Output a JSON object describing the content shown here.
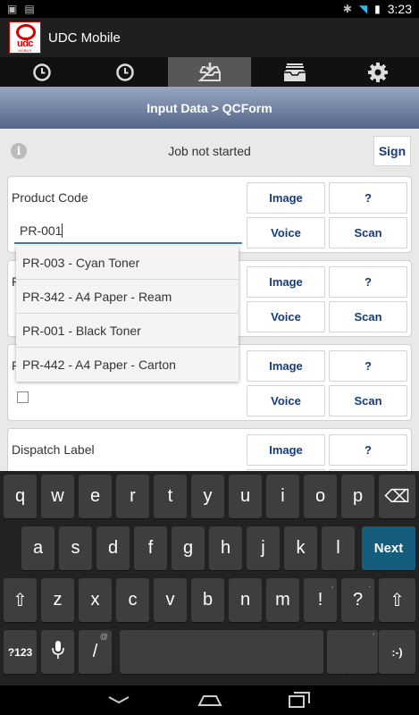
{
  "status_bar": {
    "time": "3:23"
  },
  "app": {
    "title": "UDC Mobile",
    "logo_text": "udc",
    "logo_subtext": "MOBILE"
  },
  "tabs": [
    {
      "icon": "clock-icon"
    },
    {
      "icon": "clock-icon"
    },
    {
      "icon": "inbox-download-icon",
      "active": true
    },
    {
      "icon": "archive-icon"
    },
    {
      "icon": "gear-icon"
    }
  ],
  "breadcrumb": "Input Data > QCForm",
  "job": {
    "status": "Job not started",
    "sign_label": "Sign"
  },
  "fields": [
    {
      "label": "Product Code",
      "value": "PR-001"
    },
    {
      "label": "P"
    },
    {
      "label": "P"
    },
    {
      "label": "Dispatch Label"
    }
  ],
  "buttons": {
    "image": "Image",
    "help": "?",
    "voice": "Voice",
    "scan": "Scan"
  },
  "suggestions": [
    "PR-003 - Cyan Toner",
    "PR-342 - A4 Paper - Ream",
    "PR-001 - Black Toner",
    "PR-442 - A4 Paper - Carton"
  ],
  "keyboard": {
    "row1": [
      "q",
      "w",
      "e",
      "r",
      "t",
      "y",
      "u",
      "i",
      "o",
      "p"
    ],
    "row2": [
      "a",
      "s",
      "d",
      "f",
      "g",
      "h",
      "j",
      "k",
      "l"
    ],
    "row3": [
      "z",
      "x",
      "c",
      "v",
      "b",
      "n",
      "m",
      "!",
      "?"
    ],
    "row3_hints": [
      "",
      "",
      "",
      "",
      "",
      "",
      "",
      ",",
      "."
    ],
    "next_label": "Next",
    "numbers_label": "?123",
    "slash_key": "/",
    "slash_hint": "@",
    "quote_hint": "\"",
    "quote_hint2": "'",
    "smiley": ":-)",
    "shift_glyph": "⇧",
    "backspace_glyph": "⌫"
  }
}
